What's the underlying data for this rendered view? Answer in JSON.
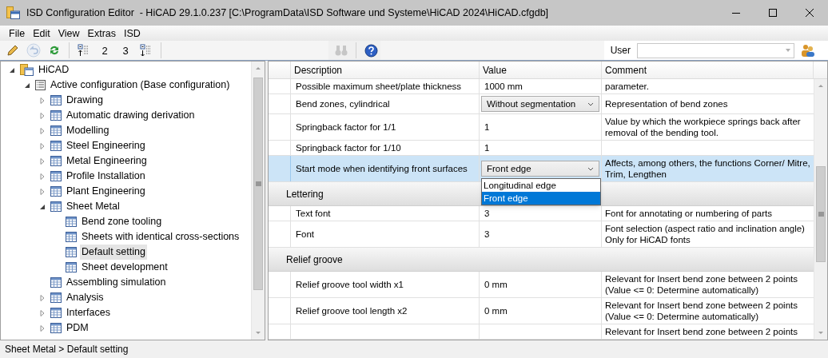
{
  "window": {
    "title": "ISD Configuration Editor  - HiCAD 29.1.0.237 [C:\\ProgramData\\ISD Software und Systeme\\HiCAD 2024\\HiCAD.cfgdb]"
  },
  "menu": [
    "File",
    "Edit",
    "View",
    "Extras",
    "ISD"
  ],
  "toolbar": [
    {
      "kind": "pencil",
      "disabled": false
    },
    {
      "kind": "undo",
      "disabled": true
    },
    {
      "kind": "refresh",
      "disabled": false
    },
    {
      "kind": "sep"
    },
    {
      "kind": "collapse",
      "disabled": false
    },
    {
      "kind": "level",
      "label": "2",
      "disabled": false
    },
    {
      "kind": "level",
      "label": "3",
      "disabled": false
    },
    {
      "kind": "expand",
      "disabled": false
    },
    {
      "kind": "sep"
    }
  ],
  "grid_toolbar": [
    {
      "kind": "find",
      "disabled": true
    },
    {
      "kind": "sep"
    },
    {
      "kind": "help",
      "disabled": false
    }
  ],
  "user": {
    "label": "User"
  },
  "tree": [
    {
      "label": "HiCAD",
      "kind": "root",
      "expanded": true,
      "selected": false,
      "children": [
        {
          "label": "Active configuration (Base configuration)",
          "kind": "config",
          "expanded": true,
          "selected": false,
          "children": [
            {
              "label": "Drawing",
              "kind": "branch",
              "expanded": false,
              "selected": false
            },
            {
              "label": "Automatic drawing derivation",
              "kind": "branch",
              "expanded": false,
              "selected": false
            },
            {
              "label": "Modelling",
              "kind": "branch",
              "expanded": false,
              "selected": false
            },
            {
              "label": "Steel Engineering",
              "kind": "branch",
              "expanded": false,
              "selected": false
            },
            {
              "label": "Metal Engineering",
              "kind": "branch",
              "expanded": false,
              "selected": false
            },
            {
              "label": "Profile Installation",
              "kind": "branch",
              "expanded": false,
              "selected": false
            },
            {
              "label": "Plant Engineering",
              "kind": "branch",
              "expanded": false,
              "selected": false
            },
            {
              "label": "Sheet Metal",
              "kind": "branch",
              "expanded": true,
              "selected": false,
              "children": [
                {
                  "label": "Bend zone tooling",
                  "kind": "leaf",
                  "selected": false
                },
                {
                  "label": "Sheets with identical cross-sections",
                  "kind": "leaf",
                  "selected": false
                },
                {
                  "label": "Default setting",
                  "kind": "leaf",
                  "selected": true
                },
                {
                  "label": "Sheet development",
                  "kind": "leaf",
                  "selected": false
                }
              ]
            },
            {
              "label": "Assembling simulation",
              "kind": "leaf",
              "selected": false
            },
            {
              "label": "Analysis",
              "kind": "branch",
              "expanded": false,
              "selected": false
            },
            {
              "label": "Interfaces",
              "kind": "branch",
              "expanded": false,
              "selected": false
            },
            {
              "label": "PDM",
              "kind": "branch",
              "expanded": false,
              "selected": false
            }
          ]
        }
      ]
    }
  ],
  "grid": {
    "columns": [
      "Description",
      "Value",
      "Comment"
    ],
    "rows": [
      {
        "kind": "text",
        "description": "Possible maximum sheet/plate thickness",
        "value": "1000 mm",
        "comment": "parameter.",
        "selected": false
      },
      {
        "kind": "combo",
        "description": "Bend zones, cylindrical",
        "value": "Without segmentation",
        "comment": "Representation of bend zones",
        "selected": false
      },
      {
        "kind": "text",
        "description": "Springback factor for 1/1",
        "value": "1",
        "comment": "Value by which the workpiece springs back after removal of the bending tool.",
        "selected": false
      },
      {
        "kind": "text",
        "description": "Springback factor for 1/10",
        "value": "1",
        "selected": false
      },
      {
        "kind": "combo",
        "description": "Start mode when identifying front surfaces",
        "value": "Front edge",
        "comment": "Affects, among others, the functions Corner/ Mitre, Trim, Lengthen",
        "selected": true,
        "dropdown": [
          {
            "label": "Longitudinal edge",
            "selected": false
          },
          {
            "label": "Front edge",
            "selected": true
          }
        ]
      },
      {
        "kind": "group",
        "description": "Lettering"
      },
      {
        "kind": "text",
        "description": "Text font",
        "value": "3",
        "comment": "Font for annotating or numbering of parts",
        "selected": false
      },
      {
        "kind": "text",
        "description": "Font",
        "value": "3",
        "comment": "Font selection (aspect ratio and inclination angle)\nOnly for HiCAD fonts",
        "selected": false
      },
      {
        "kind": "group",
        "description": "Relief groove"
      },
      {
        "kind": "text",
        "description": "Relief groove tool width x1",
        "value": "0 mm",
        "comment": "Relevant for Insert bend zone between 2 points (Value <= 0: Determine automatically)",
        "selected": false
      },
      {
        "kind": "text",
        "description": "Relief groove tool length x2",
        "value": "0 mm",
        "comment": "Relevant for Insert bend zone between 2 points (Value <= 0: Determine automatically)",
        "selected": false
      },
      {
        "kind": "text",
        "comment": "Relevant for Insert bend zone between 2 points",
        "selected": false
      }
    ]
  },
  "status_bar": "Sheet Metal > Default setting"
}
